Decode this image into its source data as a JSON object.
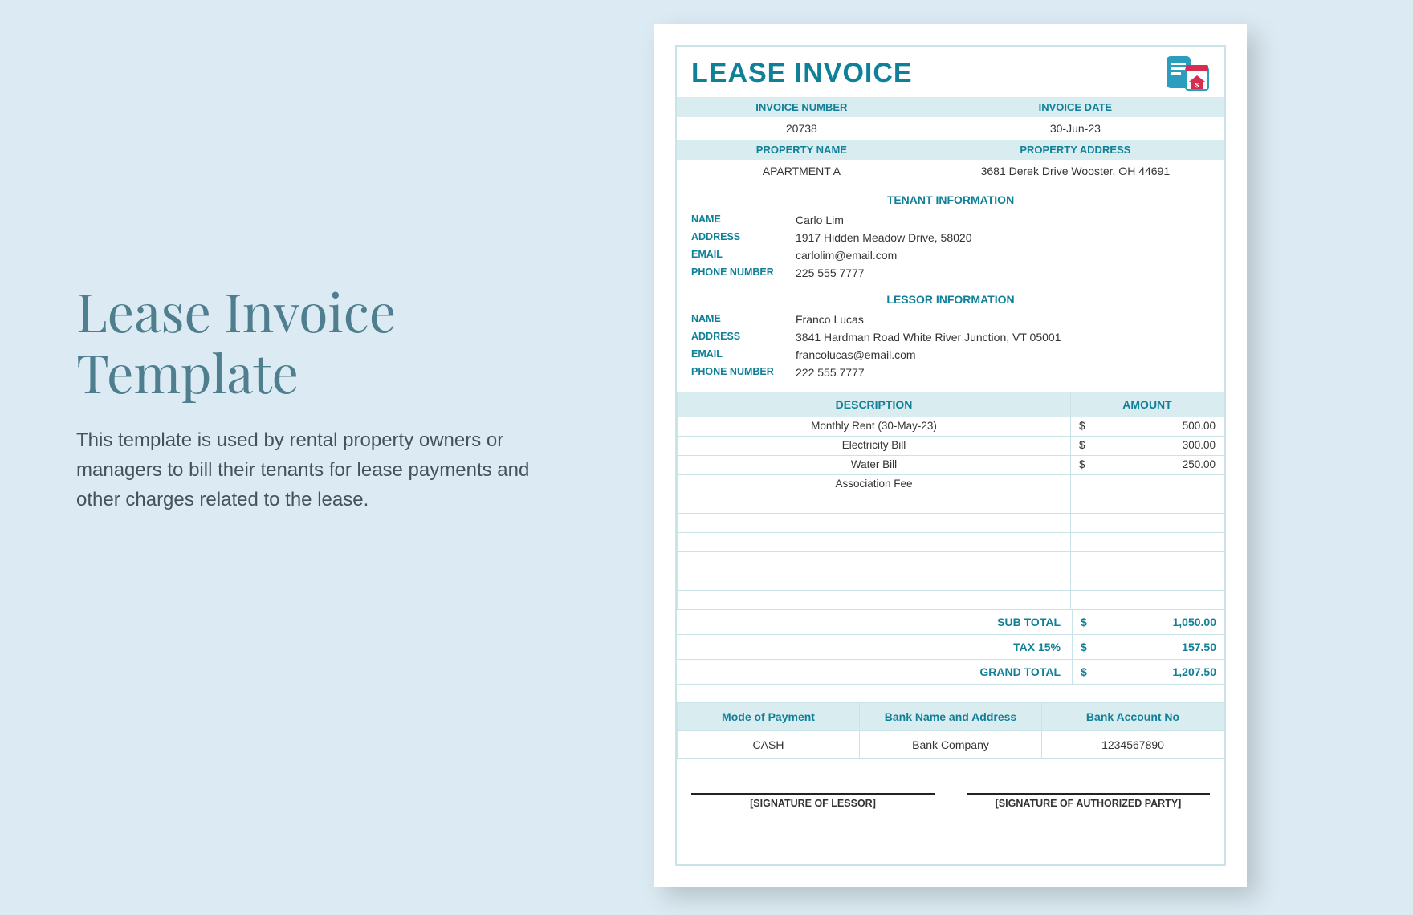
{
  "leftPanel": {
    "title": "Lease Invoice Template",
    "description": "This template is used by rental property owners or managers to bill their tenants for lease payments and other charges related to the lease."
  },
  "invoice": {
    "title": "LEASE INVOICE",
    "headers": {
      "invoiceNumber": "INVOICE NUMBER",
      "invoiceDate": "INVOICE DATE",
      "propertyName": "PROPERTY NAME",
      "propertyAddress": "PROPERTY ADDRESS"
    },
    "values": {
      "invoiceNumber": "20738",
      "invoiceDate": "30-Jun-23",
      "propertyName": "APARTMENT A",
      "propertyAddress": "3681 Derek Drive Wooster, OH 44691"
    },
    "tenantSection": "TENANT INFORMATION",
    "lessorSection": "LESSOR INFORMATION",
    "labels": {
      "name": "NAME",
      "address": "ADDRESS",
      "email": "EMAIL",
      "phone": "PHONE NUMBER"
    },
    "tenant": {
      "name": "Carlo Lim",
      "address": "1917 Hidden Meadow Drive, 58020",
      "email": "carlolim@email.com",
      "phone": "225 555 7777"
    },
    "lessor": {
      "name": "Franco Lucas",
      "address": "3841 Hardman Road White River Junction, VT 05001",
      "email": "francolucas@email.com",
      "phone": "222 555 7777"
    },
    "itemsHeader": {
      "desc": "DESCRIPTION",
      "amount": "AMOUNT"
    },
    "currency": "$",
    "items": [
      {
        "desc": "Monthly Rent (30-May-23)",
        "amount": "500.00"
      },
      {
        "desc": "Electricity Bill",
        "amount": "300.00"
      },
      {
        "desc": "Water Bill",
        "amount": "250.00"
      },
      {
        "desc": "Association Fee",
        "amount": ""
      },
      {
        "desc": "",
        "amount": ""
      },
      {
        "desc": "",
        "amount": ""
      },
      {
        "desc": "",
        "amount": ""
      },
      {
        "desc": "",
        "amount": ""
      },
      {
        "desc": "",
        "amount": ""
      },
      {
        "desc": "",
        "amount": ""
      }
    ],
    "totals": {
      "subtotalLabel": "SUB TOTAL",
      "subtotal": "1,050.00",
      "taxLabel": "TAX 15%",
      "tax": "157.50",
      "grandLabel": "GRAND TOTAL",
      "grand": "1,207.50"
    },
    "payment": {
      "headers": {
        "mode": "Mode of Payment",
        "bank": "Bank Name and Address",
        "acct": "Bank Account No"
      },
      "values": {
        "mode": "CASH",
        "bank": "Bank Company",
        "acct": "1234567890"
      }
    },
    "signatures": {
      "lessor": "[SIGNATURE OF LESSOR]",
      "authorized": "[SIGNATURE OF AUTHORIZED PARTY]"
    }
  }
}
